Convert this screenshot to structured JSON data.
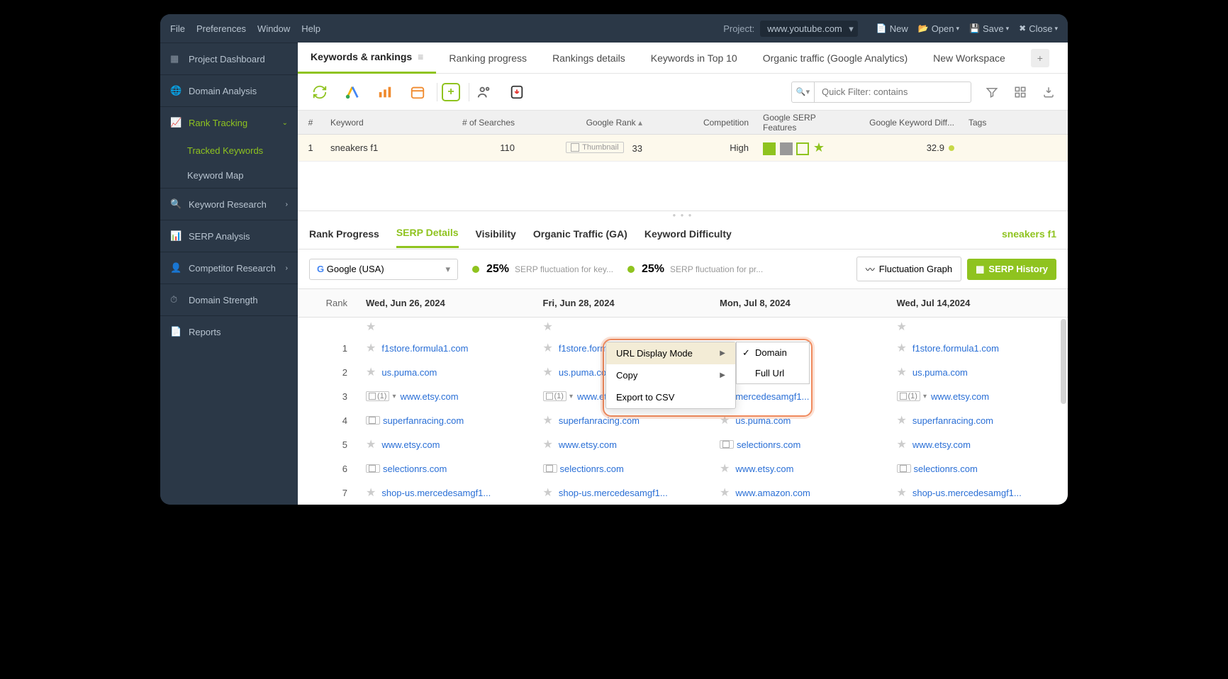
{
  "menubar": {
    "items": [
      "File",
      "Preferences",
      "Window",
      "Help"
    ],
    "projectLabel": "Project:",
    "projectValue": "www.youtube.com",
    "new": "New",
    "open": "Open",
    "save": "Save",
    "close": "Close"
  },
  "sidebar": {
    "items": [
      {
        "label": "Project Dashboard"
      },
      {
        "label": "Domain Analysis"
      },
      {
        "label": "Rank Tracking",
        "active": true
      },
      {
        "label": "Keyword Research",
        "chev": true
      },
      {
        "label": "SERP Analysis"
      },
      {
        "label": "Competitor Research",
        "chev": true
      },
      {
        "label": "Domain Strength"
      },
      {
        "label": "Reports"
      }
    ],
    "subs": [
      {
        "label": "Tracked Keywords",
        "active": true
      },
      {
        "label": "Keyword Map"
      }
    ]
  },
  "tabs": [
    "Keywords & rankings",
    "Ranking progress",
    "Rankings details",
    "Keywords in Top 10",
    "Organic traffic (Google Analytics)",
    "New Workspace"
  ],
  "quickFilter": "Quick Filter: contains",
  "gridHeaders": {
    "num": "#",
    "kw": "Keyword",
    "srch": "# of Searches",
    "grank": "Google Rank",
    "comp": "Competition",
    "feat": "Google SERP Features",
    "diff": "Google Keyword Diff...",
    "tags": "Tags"
  },
  "gridRow": {
    "num": "1",
    "kw": "sneakers f1",
    "srch": "110",
    "grank": "33",
    "thumb": "Thumbnail",
    "comp": "High",
    "diff": "32.9"
  },
  "subtabs": [
    "Rank Progress",
    "SERP Details",
    "Visibility",
    "Organic Traffic (GA)",
    "Keyword Difficulty"
  ],
  "activeKeyword": "sneakers f1",
  "searchEngine": "Google (USA)",
  "fluct": {
    "pct1": "25%",
    "label1": "SERP fluctuation for key...",
    "pct2": "25%",
    "label2": "SERP fluctuation for pr..."
  },
  "btnFluctGraph": "Fluctuation Graph",
  "btnSerpHistory": "SERP History",
  "serpDates": [
    "Wed, Jun 26, 2024",
    "Fri, Jun 28, 2024",
    "Mon, Jul 8, 2024",
    "Wed,  Jul 14,2024"
  ],
  "rankLabel": "Rank",
  "serpRows": [
    {
      "rank": "1",
      "cells": [
        {
          "t": "star",
          "u": "f1store.formula1.com"
        },
        {
          "t": "star",
          "u": "f1store.formula"
        },
        {
          "t": "none",
          "u": ""
        },
        {
          "t": "star",
          "u": "f1store.formula1.com"
        }
      ]
    },
    {
      "rank": "2",
      "cells": [
        {
          "t": "star",
          "u": "us.puma.com"
        },
        {
          "t": "star",
          "u": "us.puma.com"
        },
        {
          "t": "none",
          "u": ""
        },
        {
          "t": "star",
          "u": "us.puma.com"
        }
      ]
    },
    {
      "rank": "3",
      "cells": [
        {
          "t": "img",
          "u": "www.etsy.com"
        },
        {
          "t": "img",
          "u": "www.etsy"
        },
        {
          "t": "star",
          "u": "mercedesamgf1..."
        },
        {
          "t": "img",
          "u": "www.etsy.com"
        }
      ]
    },
    {
      "rank": "4",
      "cells": [
        {
          "t": "box",
          "u": "superfanracing.com"
        },
        {
          "t": "star",
          "u": "superfanracing.com"
        },
        {
          "t": "star",
          "u": "us.puma.com"
        },
        {
          "t": "star",
          "u": "superfanracing.com"
        }
      ]
    },
    {
      "rank": "5",
      "cells": [
        {
          "t": "star",
          "u": "www.etsy.com"
        },
        {
          "t": "star",
          "u": "www.etsy.com"
        },
        {
          "t": "box",
          "u": "selectionrs.com"
        },
        {
          "t": "star",
          "u": "www.etsy.com"
        }
      ]
    },
    {
      "rank": "6",
      "cells": [
        {
          "t": "box",
          "u": "selectionrs.com"
        },
        {
          "t": "box",
          "u": "selectionrs.com"
        },
        {
          "t": "star",
          "u": "www.etsy.com"
        },
        {
          "t": "box",
          "u": "selectionrs.com"
        }
      ]
    },
    {
      "rank": "7",
      "cells": [
        {
          "t": "star",
          "u": "shop-us.mercedesamgf1..."
        },
        {
          "t": "star",
          "u": "shop-us.mercedesamgf1..."
        },
        {
          "t": "star",
          "u": "www.amazon.com"
        },
        {
          "t": "star",
          "u": "shop-us.mercedesamgf1..."
        }
      ]
    }
  ],
  "contextMenu": {
    "items": [
      "URL Display Mode",
      "Copy",
      "Export to CSV"
    ],
    "sub": [
      "Domain",
      "Full Url"
    ]
  }
}
